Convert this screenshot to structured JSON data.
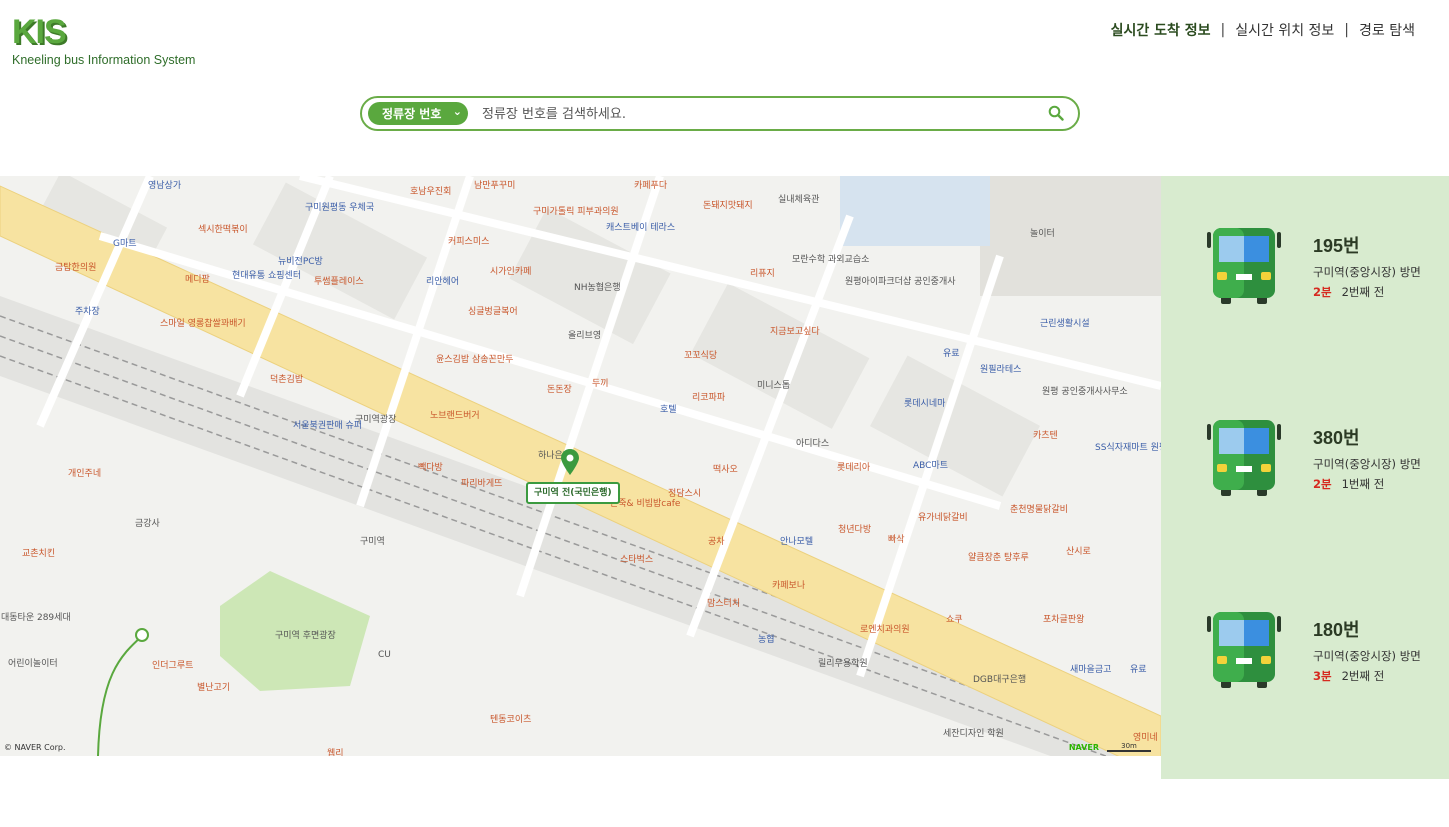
{
  "logo": {
    "mark": "KIS",
    "subtitle": "Kneeling bus Information System"
  },
  "nav": {
    "items": [
      "실시간 도착 정보",
      "실시간 위치 정보",
      "경로 탐색"
    ],
    "separator": "|",
    "active_index": 0
  },
  "search": {
    "select_label": "정류장 번호",
    "select_icon": "chevron-down-icon",
    "placeholder": "정류장 번호를 검색하세요.",
    "value": ""
  },
  "map": {
    "selected_stop": "구미역 전(국민은행)",
    "copyright": "© NAVER Corp.",
    "brand": "NAVER",
    "scale": "30m",
    "labels": [
      {
        "text": "영남상가",
        "kind": "b"
      },
      {
        "text": "구미원평동 우체국",
        "kind": "b"
      },
      {
        "text": "호남우진회",
        "kind": "o"
      },
      {
        "text": "남만푸꾸미",
        "kind": "o"
      },
      {
        "text": "구미가톨릭 피부과의원",
        "kind": "o"
      },
      {
        "text": "카페푸다",
        "kind": "o"
      },
      {
        "text": "돈돼지맛돼지",
        "kind": "o"
      },
      {
        "text": "실내체육관",
        "kind": "g"
      },
      {
        "text": "놀이터",
        "kind": "g"
      },
      {
        "text": "섹시한떡볶이",
        "kind": "o"
      },
      {
        "text": "G마트",
        "kind": "b"
      },
      {
        "text": "뉴비전PC방",
        "kind": "b"
      },
      {
        "text": "커피스미스",
        "kind": "o"
      },
      {
        "text": "캐스트베이 테라스",
        "kind": "b"
      },
      {
        "text": "모란수학 과외교습소",
        "kind": "g"
      },
      {
        "text": "금탑한의원",
        "kind": "o"
      },
      {
        "text": "메디팜",
        "kind": "o"
      },
      {
        "text": "현대유통 쇼핑센터",
        "kind": "b"
      },
      {
        "text": "투썸플레이스",
        "kind": "o"
      },
      {
        "text": "리안헤어",
        "kind": "b"
      },
      {
        "text": "시가인카페",
        "kind": "o"
      },
      {
        "text": "NH농협은행",
        "kind": "g"
      },
      {
        "text": "리퓨지",
        "kind": "o"
      },
      {
        "text": "원평아이파크더샵 공인중개사",
        "kind": "g"
      },
      {
        "text": "주차장",
        "kind": "b"
      },
      {
        "text": "스마일 영롱찹쌀꽈배기",
        "kind": "o"
      },
      {
        "text": "싱글벙글복어",
        "kind": "o"
      },
      {
        "text": "올리브영",
        "kind": "g"
      },
      {
        "text": "지금보고싶다",
        "kind": "o"
      },
      {
        "text": "근린생활시설",
        "kind": "b"
      },
      {
        "text": "윤스김밥 삼송꼰만두",
        "kind": "o"
      },
      {
        "text": "꼬꼬식당",
        "kind": "o"
      },
      {
        "text": "유료",
        "kind": "b"
      },
      {
        "text": "원필라테스",
        "kind": "b"
      },
      {
        "text": "덕촌김밥",
        "kind": "o"
      },
      {
        "text": "돈돈장",
        "kind": "o"
      },
      {
        "text": "두끼",
        "kind": "o"
      },
      {
        "text": "미니스톱",
        "kind": "g"
      },
      {
        "text": "원평 공인중개사사무소",
        "kind": "g"
      },
      {
        "text": "리코파파",
        "kind": "o"
      },
      {
        "text": "롯데시네마",
        "kind": "b"
      },
      {
        "text": "서울북권판매 슈퍼",
        "kind": "b"
      },
      {
        "text": "구미역광장",
        "kind": "g"
      },
      {
        "text": "노브랜드버거",
        "kind": "o"
      },
      {
        "text": "호텔",
        "kind": "b"
      },
      {
        "text": "카츠텐",
        "kind": "o"
      },
      {
        "text": "아디다스",
        "kind": "g"
      },
      {
        "text": "SS식자재마트 원평점",
        "kind": "b"
      },
      {
        "text": "하나은행",
        "kind": "g"
      },
      {
        "text": "떡사오",
        "kind": "o"
      },
      {
        "text": "롯데리아",
        "kind": "o"
      },
      {
        "text": "ABC마트",
        "kind": "b"
      },
      {
        "text": "빽다방",
        "kind": "o"
      },
      {
        "text": "파리바게뜨",
        "kind": "o"
      },
      {
        "text": "개인주네",
        "kind": "o"
      },
      {
        "text": "정담스시",
        "kind": "o"
      },
      {
        "text": "본죽& 비빔밥cafe",
        "kind": "o"
      },
      {
        "text": "유가네닭갈비",
        "kind": "o"
      },
      {
        "text": "춘천명물닭갈비",
        "kind": "o"
      },
      {
        "text": "금강사",
        "kind": "g"
      },
      {
        "text": "구미역",
        "kind": "g"
      },
      {
        "text": "청년다방",
        "kind": "o"
      },
      {
        "text": "빠삭",
        "kind": "o"
      },
      {
        "text": "산시로",
        "kind": "o"
      },
      {
        "text": "교촌치킨",
        "kind": "o"
      },
      {
        "text": "스타벅스",
        "kind": "o"
      },
      {
        "text": "공차",
        "kind": "o"
      },
      {
        "text": "안나모텔",
        "kind": "b"
      },
      {
        "text": "얄큼장춘 탕후루",
        "kind": "o"
      },
      {
        "text": "카페보나",
        "kind": "o"
      },
      {
        "text": "대동타운 289세대",
        "kind": "g"
      },
      {
        "text": "맘스터치",
        "kind": "o"
      },
      {
        "text": "쇼쿠",
        "kind": "o"
      },
      {
        "text": "포차글판왕",
        "kind": "o"
      },
      {
        "text": "구미역 후면광장",
        "kind": "g"
      },
      {
        "text": "인더그루트",
        "kind": "o"
      },
      {
        "text": "농협",
        "kind": "b"
      },
      {
        "text": "로엔치과의원",
        "kind": "o"
      },
      {
        "text": "어린이놀이터",
        "kind": "g"
      },
      {
        "text": "CU",
        "kind": "g"
      },
      {
        "text": "릴리무용학원",
        "kind": "g"
      },
      {
        "text": "새마을금고",
        "kind": "b"
      },
      {
        "text": "유료",
        "kind": "b"
      },
      {
        "text": "별난고기",
        "kind": "o"
      },
      {
        "text": "DGB대구은행",
        "kind": "g"
      },
      {
        "text": "텐동코이츠",
        "kind": "o"
      },
      {
        "text": "세잔디자인 학원",
        "kind": "g"
      },
      {
        "text": "영미네",
        "kind": "o"
      },
      {
        "text": "웹리",
        "kind": "o"
      }
    ]
  },
  "arrivals": [
    {
      "route": "195번",
      "direction": "구미역(중앙시장) 방면",
      "eta": "2분",
      "stops": "2번째 전"
    },
    {
      "route": "380번",
      "direction": "구미역(중앙시장) 방면",
      "eta": "2분",
      "stops": "1번째 전"
    },
    {
      "route": "180번",
      "direction": "구미역(중앙시장) 방면",
      "eta": "3분",
      "stops": "2번째 전"
    }
  ],
  "colors": {
    "brand": "#5aa83e",
    "panel": "#d8ebcf",
    "eta": "#d62a20",
    "road_main": "#f7e3a1"
  }
}
